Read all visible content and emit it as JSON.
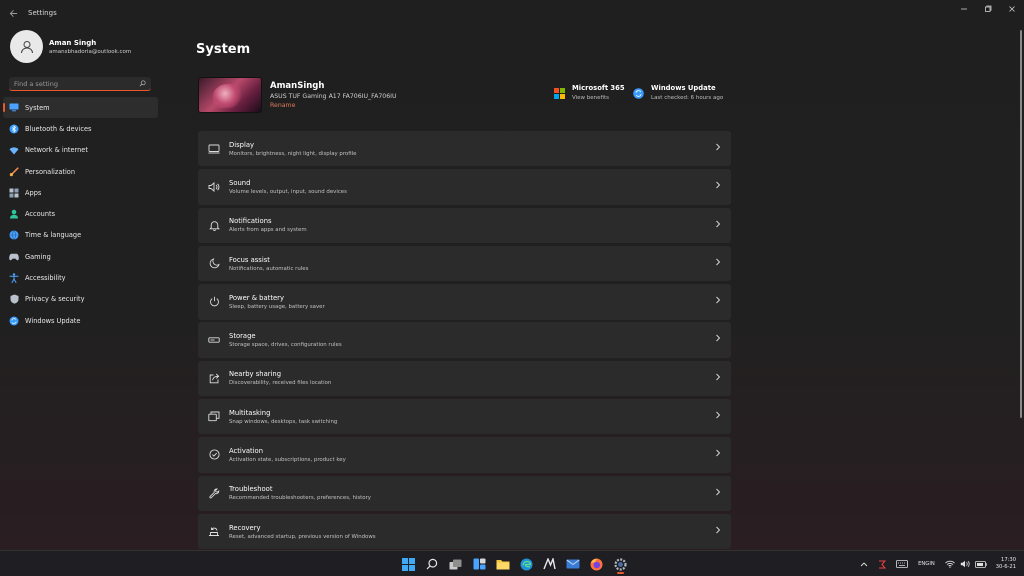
{
  "window": {
    "title": "Settings"
  },
  "profile": {
    "name": "Aman Singh",
    "email": "amansbhadoria@outlook.com"
  },
  "search": {
    "placeholder": "Find a setting"
  },
  "nav": {
    "items": [
      {
        "label": "System",
        "icon": "monitor-icon",
        "color": "#4aa3ff",
        "active": true
      },
      {
        "label": "Bluetooth & devices",
        "icon": "bluetooth-icon",
        "color": "#3b9cff"
      },
      {
        "label": "Network & internet",
        "icon": "wifi-icon",
        "color": "#6ab4ff"
      },
      {
        "label": "Personalization",
        "icon": "brush-icon",
        "color": "#f08a4b"
      },
      {
        "label": "Apps",
        "icon": "apps-icon",
        "color": "#b9c2cc"
      },
      {
        "label": "Accounts",
        "icon": "person-icon",
        "color": "#2fc59d"
      },
      {
        "label": "Time & language",
        "icon": "globe-icon",
        "color": "#4aa3ff"
      },
      {
        "label": "Gaming",
        "icon": "gamepad-icon",
        "color": "#b9c2cc"
      },
      {
        "label": "Accessibility",
        "icon": "accessibility-icon",
        "color": "#4aa3ff"
      },
      {
        "label": "Privacy & security",
        "icon": "shield-icon",
        "color": "#b9c2cc"
      },
      {
        "label": "Windows Update",
        "icon": "update-icon",
        "color": "#3b9cff"
      }
    ]
  },
  "main": {
    "title": "System",
    "device": {
      "name": "AmanSingh",
      "model": "ASUS TUF Gaming A17 FA706IU_FA706IU",
      "rename": "Rename"
    },
    "quick": {
      "m365": {
        "title": "Microsoft 365",
        "sub": "View benefits"
      },
      "update": {
        "title": "Windows Update",
        "sub": "Last checked: 6 hours ago"
      }
    },
    "cards": [
      {
        "title": "Display",
        "sub": "Monitors, brightness, night light, display profile",
        "icon": "display-icon"
      },
      {
        "title": "Sound",
        "sub": "Volume levels, output, input, sound devices",
        "icon": "speaker-icon"
      },
      {
        "title": "Notifications",
        "sub": "Alerts from apps and system",
        "icon": "bell-icon"
      },
      {
        "title": "Focus assist",
        "sub": "Notifications, automatic rules",
        "icon": "moon-icon"
      },
      {
        "title": "Power & battery",
        "sub": "Sleep, battery usage, battery saver",
        "icon": "power-icon"
      },
      {
        "title": "Storage",
        "sub": "Storage space, drives, configuration rules",
        "icon": "storage-icon"
      },
      {
        "title": "Nearby sharing",
        "sub": "Discoverability, received files location",
        "icon": "share-icon"
      },
      {
        "title": "Multitasking",
        "sub": "Snap windows, desktops, task switching",
        "icon": "multitask-icon"
      },
      {
        "title": "Activation",
        "sub": "Activation state, subscriptions, product key",
        "icon": "check-circle-icon"
      },
      {
        "title": "Troubleshoot",
        "sub": "Recommended troubleshooters, preferences, history",
        "icon": "wrench-icon"
      },
      {
        "title": "Recovery",
        "sub": "Reset, advanced startup, previous version of Windows",
        "icon": "recovery-icon"
      }
    ]
  },
  "taskbar": {
    "apps": [
      "windows-start-icon",
      "search-icon",
      "task-view-icon",
      "widgets-icon",
      "file-explorer-icon",
      "edge-icon",
      "app-icon",
      "mail-icon",
      "firefox-icon",
      "settings-icon"
    ],
    "active_app": "settings-icon",
    "tray": {
      "lang_top": "ENG",
      "lang_bottom": "IN",
      "time": "17:30",
      "date": "30-6-21"
    }
  }
}
